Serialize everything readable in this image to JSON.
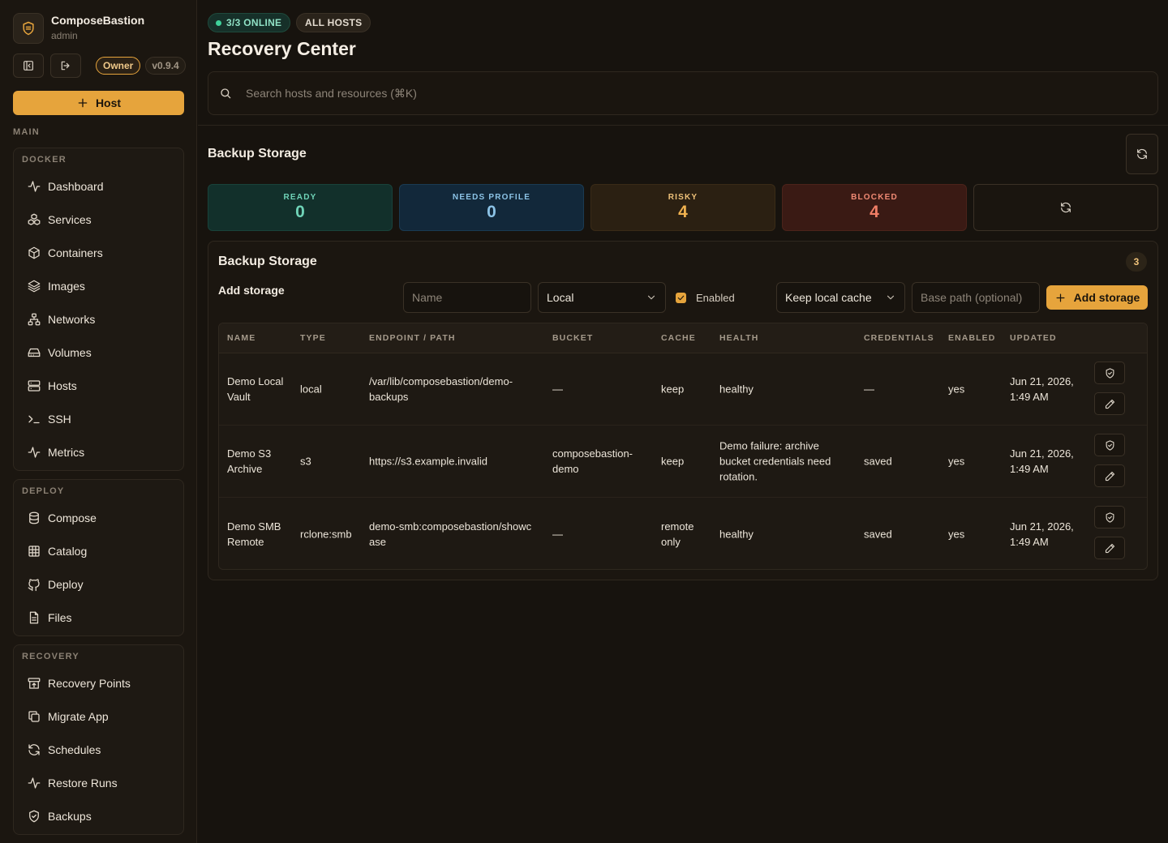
{
  "brand": {
    "name": "ComposeBastion",
    "user": "admin",
    "role": "Owner",
    "version": "v0.9.4"
  },
  "sidebar": {
    "host_button": "Host",
    "main_label": "MAIN",
    "groups": [
      {
        "title": "DOCKER",
        "items": [
          {
            "label": "Dashboard",
            "icon": "activity-icon"
          },
          {
            "label": "Services",
            "icon": "services-icon"
          },
          {
            "label": "Containers",
            "icon": "box-icon"
          },
          {
            "label": "Images",
            "icon": "layers-icon"
          },
          {
            "label": "Networks",
            "icon": "network-icon"
          },
          {
            "label": "Volumes",
            "icon": "drive-icon"
          },
          {
            "label": "Hosts",
            "icon": "server-icon"
          },
          {
            "label": "SSH",
            "icon": "terminal-icon"
          },
          {
            "label": "Metrics",
            "icon": "activity-icon"
          }
        ]
      },
      {
        "title": "DEPLOY",
        "items": [
          {
            "label": "Compose",
            "icon": "database-icon"
          },
          {
            "label": "Catalog",
            "icon": "grid-icon"
          },
          {
            "label": "Deploy",
            "icon": "github-icon"
          },
          {
            "label": "Files",
            "icon": "file-icon"
          }
        ]
      },
      {
        "title": "RECOVERY",
        "items": [
          {
            "label": "Recovery Points",
            "icon": "archive-icon"
          },
          {
            "label": "Migrate App",
            "icon": "copy-icon"
          },
          {
            "label": "Schedules",
            "icon": "refresh-icon"
          },
          {
            "label": "Restore Runs",
            "icon": "activity-icon"
          },
          {
            "label": "Backups",
            "icon": "shield-icon"
          }
        ]
      }
    ]
  },
  "header": {
    "online_pill": "3/3 ONLINE",
    "hosts_pill": "ALL HOSTS",
    "title": "Recovery Center",
    "search_placeholder": "Search hosts and resources (⌘K)"
  },
  "section": {
    "title": "Backup Storage"
  },
  "stats": [
    {
      "label": "READY",
      "value": "0"
    },
    {
      "label": "NEEDS PROFILE",
      "value": "0"
    },
    {
      "label": "RISKY",
      "value": "4"
    },
    {
      "label": "BLOCKED",
      "value": "4"
    }
  ],
  "panel": {
    "title": "Backup Storage",
    "count": "3",
    "add_label": "Add storage",
    "name_placeholder": "Name",
    "type_value": "Local",
    "enabled_label": "Enabled",
    "cache_value": "Keep local cache",
    "base_path_placeholder": "Base path (optional)",
    "add_button": "Add storage"
  },
  "table": {
    "headers": [
      "NAME",
      "TYPE",
      "ENDPOINT / PATH",
      "BUCKET",
      "CACHE",
      "HEALTH",
      "CREDENTIALS",
      "ENABLED",
      "UPDATED"
    ],
    "rows": [
      {
        "name": "Demo Local Vault",
        "type": "local",
        "endpoint": "/var/lib/composebastion/demo-backups",
        "bucket": "—",
        "cache": "keep",
        "health": "healthy",
        "credentials": "—",
        "enabled": "yes",
        "updated": "Jun 21, 2026, 1:49 AM"
      },
      {
        "name": "Demo S3 Archive",
        "type": "s3",
        "endpoint": "https://s3.example.invalid",
        "bucket": "composebastion-demo",
        "cache": "keep",
        "health": "Demo failure: archive bucket credentials need rotation.",
        "credentials": "saved",
        "enabled": "yes",
        "updated": "Jun 21, 2026, 1:49 AM"
      },
      {
        "name": "Demo SMB Remote",
        "type": "rclone:smb",
        "endpoint": "demo-smb:composebastion/showcase",
        "bucket": "—",
        "cache": "remote only",
        "health": "healthy",
        "credentials": "saved",
        "enabled": "yes",
        "updated": "Jun 21, 2026, 1:49 AM"
      }
    ]
  }
}
